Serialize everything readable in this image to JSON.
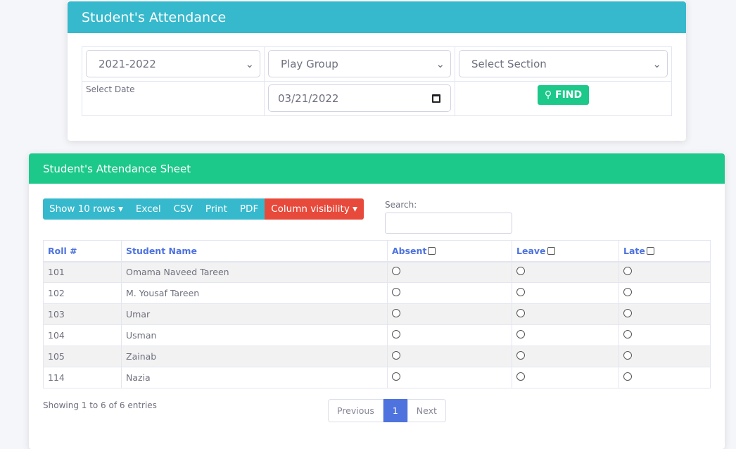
{
  "filter_card": {
    "title": "Student's Attendance",
    "session": "2021-2022",
    "class": "Play Group",
    "section": "Select Section",
    "date_label": "Select Date",
    "date": "03/21/2022",
    "find_label": "FIND"
  },
  "sheet": {
    "title": "Student's Attendance Sheet",
    "buttons": [
      "Show 10 rows ▾",
      "Excel",
      "CSV",
      "Print",
      "PDF",
      "Column visibility ▾"
    ],
    "search_label": "Search:",
    "columns": [
      "Roll #",
      "Student Name",
      "Absent",
      "Leave",
      "Late"
    ],
    "rows": [
      [
        "101",
        "Omama Naveed Tareen"
      ],
      [
        "102",
        "M. Yousaf Tareen"
      ],
      [
        "103",
        "Umar"
      ],
      [
        "104",
        "Usman"
      ],
      [
        "105",
        "Zainab"
      ],
      [
        "114",
        "Nazia"
      ]
    ],
    "info": "Showing 1 to 6 of 6 entries",
    "pagination": {
      "prev": "Previous",
      "current": "1",
      "next": "Next"
    }
  }
}
